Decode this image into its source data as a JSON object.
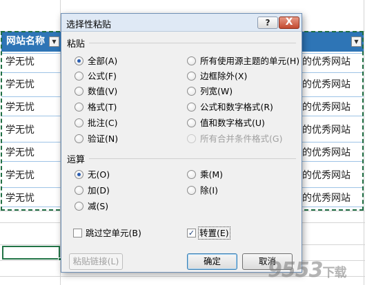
{
  "sheet": {
    "header_cell": "网站名称",
    "rows_left": [
      "学无忧",
      "学无忧",
      "学无忧",
      "学无忧",
      "学无忧",
      "学无忧",
      "学无忧"
    ],
    "rows_right": [
      "的优秀网站",
      "的优秀网站",
      "的优秀网站",
      "的优秀网站",
      "的优秀网站",
      "的优秀网站",
      "的优秀网站"
    ],
    "header_color": "#2e75b6"
  },
  "dialog": {
    "title": "选择性粘贴",
    "help_label": "?",
    "close_label": "X",
    "paste_section": "粘贴",
    "paste_left": [
      {
        "label": "全部(A)",
        "checked": true
      },
      {
        "label": "公式(F)",
        "checked": false
      },
      {
        "label": "数值(V)",
        "checked": false
      },
      {
        "label": "格式(T)",
        "checked": false
      },
      {
        "label": "批注(C)",
        "checked": false
      },
      {
        "label": "验证(N)",
        "checked": false
      }
    ],
    "paste_right": [
      {
        "label": "所有使用源主题的单元(H)",
        "checked": false
      },
      {
        "label": "边框除外(X)",
        "checked": false
      },
      {
        "label": "列宽(W)",
        "checked": false
      },
      {
        "label": "公式和数字格式(R)",
        "checked": false
      },
      {
        "label": "值和数字格式(U)",
        "checked": false
      },
      {
        "label": "所有合并条件格式(G)",
        "checked": false,
        "disabled": true
      }
    ],
    "operation_section": "运算",
    "op_left": [
      {
        "label": "无(O)",
        "checked": true
      },
      {
        "label": "加(D)",
        "checked": false
      },
      {
        "label": "减(S)",
        "checked": false
      }
    ],
    "op_right": [
      {
        "label": "乘(M)",
        "checked": false
      },
      {
        "label": "除(I)",
        "checked": false
      }
    ],
    "skip_blanks": {
      "label": "跳过空单元(B)",
      "checked": false
    },
    "transpose": {
      "label": "转置(E)",
      "checked": true
    },
    "paste_link_button": "粘贴链接(L)",
    "ok_button": "确定",
    "cancel_button": "取消"
  },
  "watermark": {
    "main": "9553",
    "sub": "下载"
  }
}
